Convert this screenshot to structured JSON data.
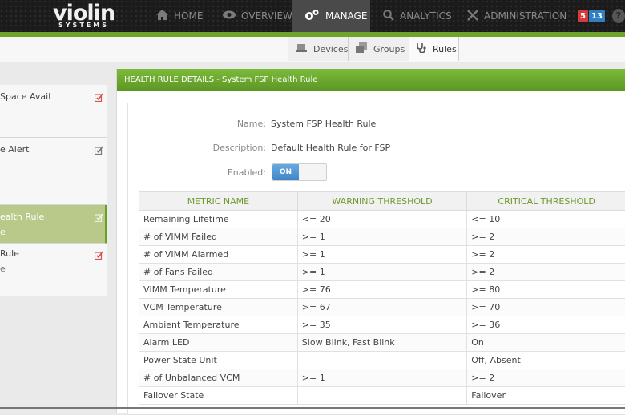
{
  "brand": {
    "name": "violin",
    "sub": "SYSTEMS"
  },
  "nav": {
    "items": [
      {
        "label": "HOME",
        "icon": "home-icon"
      },
      {
        "label": "OVERVIEW",
        "icon": "eye-icon"
      },
      {
        "label": "MANAGE",
        "icon": "gears-icon",
        "active": true
      },
      {
        "label": "ANALYTICS",
        "icon": "magnifier-icon"
      },
      {
        "label": "ADMINISTRATION",
        "icon": "tools-icon"
      }
    ],
    "alerts_red": "5",
    "alerts_blue": "13",
    "help": "?"
  },
  "subnav": {
    "tabs": [
      {
        "label": "Devices",
        "icon": "device-icon"
      },
      {
        "label": "Groups",
        "icon": "groups-icon"
      },
      {
        "label": "Rules",
        "icon": "stethoscope-icon",
        "active": true
      }
    ]
  },
  "rules_list": [
    {
      "title": "Space Avail",
      "subtitle": "",
      "edit_color": "#d9534f"
    },
    {
      "title": "e Alert",
      "subtitle": "",
      "edit_color": "#777777"
    },
    {
      "title": "ealth Rule",
      "subtitle": "e",
      "edit_color": "#ffffff",
      "active": true
    },
    {
      "title": "Rule",
      "subtitle": "e",
      "edit_color": "#d9534f"
    }
  ],
  "panel": {
    "header": "HEALTH RULE DETAILS - System FSP Health Rule",
    "name_label": "Name:",
    "name_value": "System FSP Health Rule",
    "description_label": "Description:",
    "description_value": "Default Health Rule for FSP",
    "enabled_label": "Enabled:",
    "enabled_value": "ON"
  },
  "table": {
    "headers": [
      "METRIC NAME",
      "WARNING THRESHOLD",
      "CRITICAL THRESHOLD"
    ],
    "rows": [
      [
        "Remaining Lifetime",
        "<= 20",
        "<= 10"
      ],
      [
        "# of VIMM Failed",
        ">= 1",
        ">= 2"
      ],
      [
        "# of VIMM Alarmed",
        ">= 1",
        ">= 2"
      ],
      [
        "# of Fans Failed",
        ">= 1",
        ">= 2"
      ],
      [
        "VIMM Temperature",
        ">= 76",
        ">= 80"
      ],
      [
        "VCM Temperature",
        ">= 67",
        ">= 70"
      ],
      [
        "Ambient Temperature",
        ">= 35",
        ">= 36"
      ],
      [
        "Alarm LED",
        "Slow Blink, Fast Blink",
        "On"
      ],
      [
        "Power State Unit",
        "",
        "Off, Absent"
      ],
      [
        "# of Unbalanced VCM",
        ">= 1",
        ">= 2"
      ],
      [
        "Failover State",
        "",
        "Failover"
      ]
    ]
  },
  "colors": {
    "accent_green": "#6ea32c",
    "badge_red": "#d43a3a",
    "badge_blue": "#2f7fc1",
    "toggle_blue": "#3f86c8"
  }
}
